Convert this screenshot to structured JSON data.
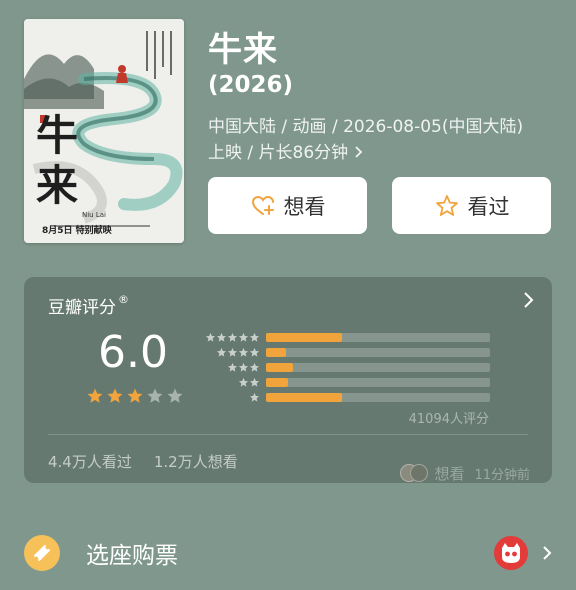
{
  "movie": {
    "title": "牛来",
    "year": "(2026)",
    "meta_line1": "中国大陆 / 动画 / 2026-08-05(中国大陆)",
    "meta_line2": "上映 / 片长86分钟",
    "poster": {
      "title_glyphs": "牛来",
      "subtitle": "Niu Lai",
      "tagline": "8月5日 特别献映"
    }
  },
  "actions": {
    "want_label": "想看",
    "seen_label": "看过"
  },
  "rating": {
    "title": "豆瓣评分",
    "registered": "®",
    "score": "6.0",
    "stars_filled": 3,
    "stars_total": 5,
    "distribution": [
      {
        "stars": 5,
        "fraction": 0.34
      },
      {
        "stars": 4,
        "fraction": 0.09
      },
      {
        "stars": 3,
        "fraction": 0.12
      },
      {
        "stars": 2,
        "fraction": 0.1
      },
      {
        "stars": 1,
        "fraction": 0.34
      }
    ],
    "count_label": "41094人评分",
    "seen_count": "4.4万人看过",
    "want_count": "1.2万人想看",
    "activity_action": "想看",
    "activity_time": "11分钟前"
  },
  "ticket": {
    "label": "选座购票"
  },
  "colors": {
    "background": "#7f978d",
    "star": "#f1a33c",
    "star_empty": "#a9b3ae",
    "ticket_icon": "#f7c15a",
    "maoyan_red": "#e33a3a"
  },
  "icons": {
    "want": "heart-plus-icon",
    "seen": "star-outline-icon",
    "ticket": "ticket-icon",
    "vendor": "maoyan-cat-icon",
    "chevron": "chevron-right-icon"
  }
}
